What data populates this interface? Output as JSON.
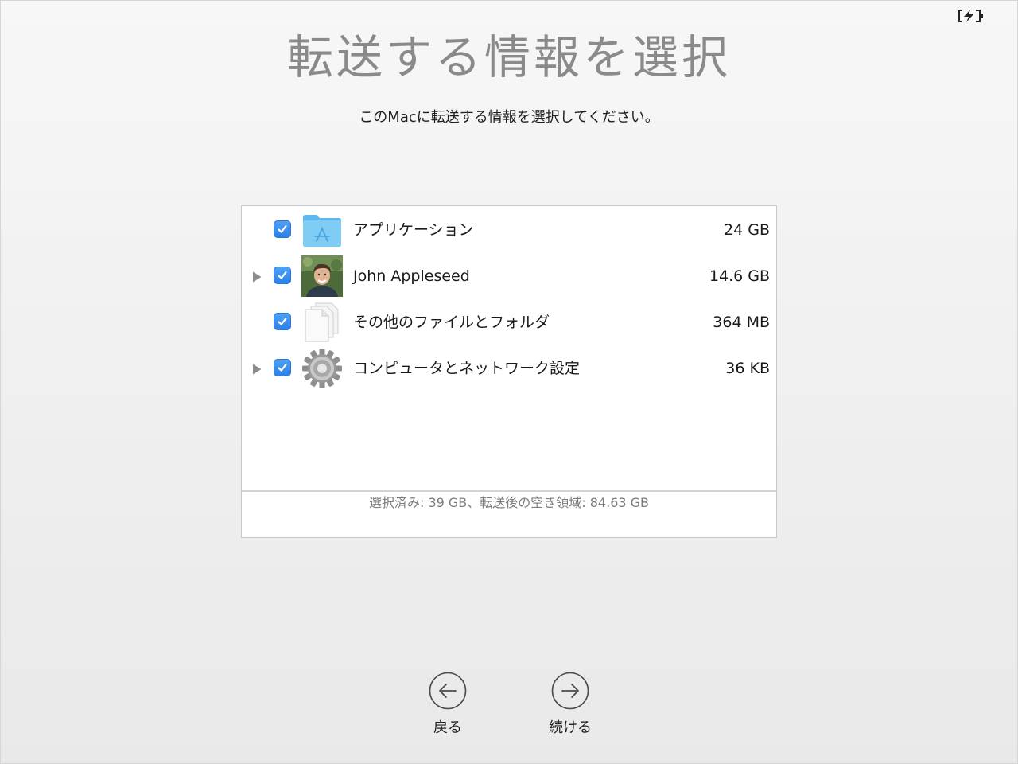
{
  "status_bar": {
    "battery_icon": "battery-charging-icon"
  },
  "page": {
    "title": "転送する情報を選択",
    "subtitle": "このMacに転送する情報を選択してください。"
  },
  "items": [
    {
      "label": "アプリケーション",
      "size": "24 GB",
      "checked": true,
      "expandable": false,
      "icon": "applications-folder-icon"
    },
    {
      "label": "John Appleseed",
      "size": "14.6 GB",
      "checked": true,
      "expandable": true,
      "icon": "user-photo-icon"
    },
    {
      "label": "その他のファイルとフォルダ",
      "size": "364 MB",
      "checked": true,
      "expandable": false,
      "icon": "documents-icon"
    },
    {
      "label": "コンピュータとネットワーク設定",
      "size": "36 KB",
      "checked": true,
      "expandable": true,
      "icon": "gear-icon"
    }
  ],
  "summary": "選択済み: 39 GB、転送後の空き領域: 84.63 GB",
  "navigation": {
    "back_label": "戻る",
    "continue_label": "続ける"
  },
  "colors": {
    "checkbox_blue": "#3a8ef0",
    "folder_blue": "#6cc3f2",
    "title_gray": "#8a8a8a",
    "summary_gray": "#7c7c7c"
  }
}
